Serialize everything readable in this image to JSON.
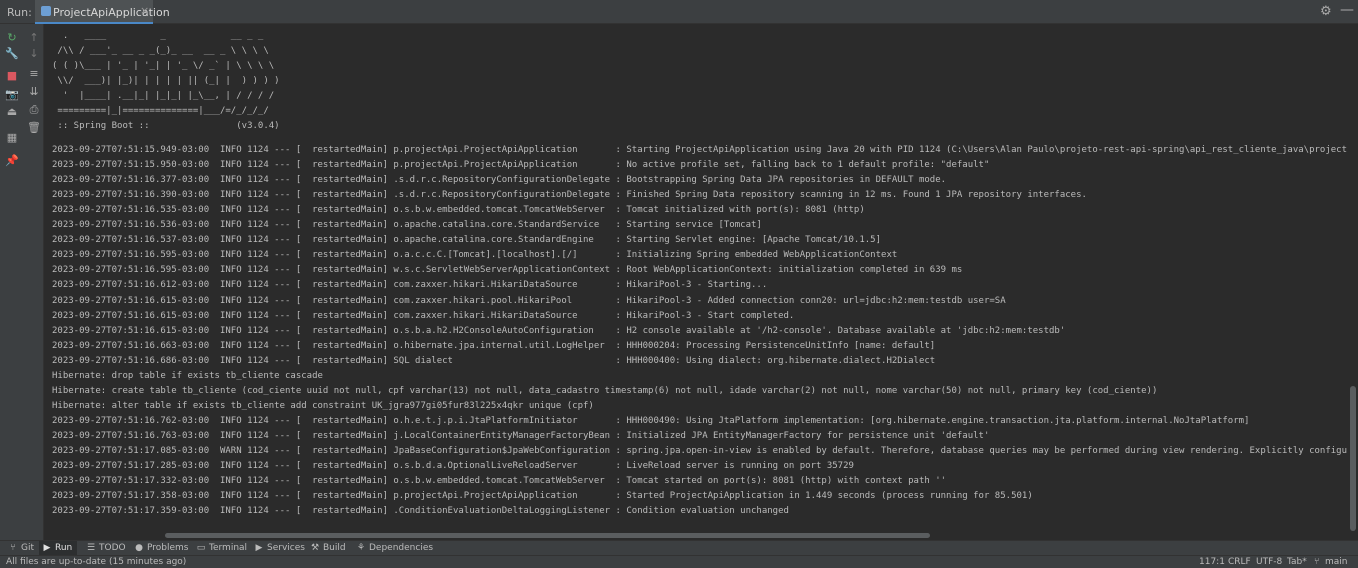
{
  "runbar": {
    "run_label": "Run:",
    "tab_title": "ProjectApiApplication",
    "tab_close": "×",
    "gear_icon": "⚙",
    "minimize_icon": "—"
  },
  "tools": {
    "left": [
      {
        "name": "rerun-icon",
        "glyph": "↻",
        "color": "#59a869"
      },
      {
        "name": "wrench-icon",
        "glyph": "🔧",
        "color": "#aaaaaa"
      },
      {
        "name": "stop-icon",
        "glyph": "■",
        "color": "#db5860"
      },
      {
        "name": "camera-icon",
        "glyph": "📷",
        "color": "#aaaaaa"
      },
      {
        "name": "exit-icon",
        "glyph": "⏏",
        "color": "#aaaaaa"
      },
      {
        "name": "layout-icon",
        "glyph": "▦",
        "color": "#aaaaaa"
      },
      {
        "name": "pin-icon",
        "glyph": "📌",
        "color": "#aaaaaa"
      }
    ],
    "second": [
      {
        "name": "up-arrow-icon",
        "glyph": "↑",
        "color": "#777777"
      },
      {
        "name": "down-arrow-icon",
        "glyph": "↓",
        "color": "#777777"
      },
      {
        "name": "soft-wrap-icon",
        "glyph": "≡",
        "color": "#aaaaaa"
      },
      {
        "name": "scroll-to-end-icon",
        "glyph": "⇊",
        "color": "#aaaaaa"
      },
      {
        "name": "print-icon",
        "glyph": "⎙",
        "color": "#aaaaaa"
      },
      {
        "name": "trash-icon",
        "glyph": "🗑",
        "color": "#aaaaaa"
      }
    ]
  },
  "banner": [
    "  .   ____          _            __ _ _",
    " /\\\\ / ___'_ __ _ _(_)_ __  __ _ \\ \\ \\ \\",
    "( ( )\\___ | '_ | '_| | '_ \\/ _` | \\ \\ \\ \\",
    " \\\\/  ___)| |_)| | | | | || (_| |  ) ) ) )",
    "  '  |____| .__|_| |_|_| |_\\__, | / / / /",
    " =========|_|==============|___/=/_/_/_/",
    " :: Spring Boot ::                (v3.0.4)"
  ],
  "logs": [
    "2023-09-27T07:51:15.949-03:00  INFO 1124 --- [  restartedMain] p.projectApi.ProjectApiApplication       : Starting ProjectApiApplication using Java 20 with PID 1124 (C:\\Users\\Alan Paulo\\projeto-rest-api-spring\\api_rest_cliente_java\\projectApi\\target\\classes",
    "2023-09-27T07:51:15.950-03:00  INFO 1124 --- [  restartedMain] p.projectApi.ProjectApiApplication       : No active profile set, falling back to 1 default profile: \"default\"",
    "2023-09-27T07:51:16.377-03:00  INFO 1124 --- [  restartedMain] .s.d.r.c.RepositoryConfigurationDelegate : Bootstrapping Spring Data JPA repositories in DEFAULT mode.",
    "2023-09-27T07:51:16.390-03:00  INFO 1124 --- [  restartedMain] .s.d.r.c.RepositoryConfigurationDelegate : Finished Spring Data repository scanning in 12 ms. Found 1 JPA repository interfaces.",
    "2023-09-27T07:51:16.535-03:00  INFO 1124 --- [  restartedMain] o.s.b.w.embedded.tomcat.TomcatWebServer  : Tomcat initialized with port(s): 8081 (http)",
    "2023-09-27T07:51:16.536-03:00  INFO 1124 --- [  restartedMain] o.apache.catalina.core.StandardService   : Starting service [Tomcat]",
    "2023-09-27T07:51:16.537-03:00  INFO 1124 --- [  restartedMain] o.apache.catalina.core.StandardEngine    : Starting Servlet engine: [Apache Tomcat/10.1.5]",
    "2023-09-27T07:51:16.595-03:00  INFO 1124 --- [  restartedMain] o.a.c.c.C.[Tomcat].[localhost].[/]       : Initializing Spring embedded WebApplicationContext",
    "2023-09-27T07:51:16.595-03:00  INFO 1124 --- [  restartedMain] w.s.c.ServletWebServerApplicationContext : Root WebApplicationContext: initialization completed in 639 ms",
    "2023-09-27T07:51:16.612-03:00  INFO 1124 --- [  restartedMain] com.zaxxer.hikari.HikariDataSource       : HikariPool-3 - Starting...",
    "2023-09-27T07:51:16.615-03:00  INFO 1124 --- [  restartedMain] com.zaxxer.hikari.pool.HikariPool        : HikariPool-3 - Added connection conn20: url=jdbc:h2:mem:testdb user=SA",
    "2023-09-27T07:51:16.615-03:00  INFO 1124 --- [  restartedMain] com.zaxxer.hikari.HikariDataSource       : HikariPool-3 - Start completed.",
    "2023-09-27T07:51:16.615-03:00  INFO 1124 --- [  restartedMain] o.s.b.a.h2.H2ConsoleAutoConfiguration    : H2 console available at '/h2-console'. Database available at 'jdbc:h2:mem:testdb'",
    "2023-09-27T07:51:16.663-03:00  INFO 1124 --- [  restartedMain] o.hibernate.jpa.internal.util.LogHelper  : HHH000204: Processing PersistenceUnitInfo [name: default]",
    "2023-09-27T07:51:16.686-03:00  INFO 1124 --- [  restartedMain] SQL dialect                              : HHH000400: Using dialect: org.hibernate.dialect.H2Dialect",
    "Hibernate: drop table if exists tb_cliente cascade",
    "Hibernate: create table tb_cliente (cod_ciente uuid not null, cpf varchar(13) not null, data_cadastro timestamp(6) not null, idade varchar(2) not null, nome varchar(50) not null, primary key (cod_ciente))",
    "Hibernate: alter table if exists tb_cliente add constraint UK_jgra977gi05fur83l225x4qkr unique (cpf)",
    "2023-09-27T07:51:16.762-03:00  INFO 1124 --- [  restartedMain] o.h.e.t.j.p.i.JtaPlatformInitiator       : HHH000490: Using JtaPlatform implementation: [org.hibernate.engine.transaction.jta.platform.internal.NoJtaPlatform]",
    "2023-09-27T07:51:16.763-03:00  INFO 1124 --- [  restartedMain] j.LocalContainerEntityManagerFactoryBean : Initialized JPA EntityManagerFactory for persistence unit 'default'",
    "2023-09-27T07:51:17.085-03:00  WARN 1124 --- [  restartedMain] JpaBaseConfiguration$JpaWebConfiguration : spring.jpa.open-in-view is enabled by default. Therefore, database queries may be performed during view rendering. Explicitly configure spring.jpa.open-",
    "2023-09-27T07:51:17.285-03:00  INFO 1124 --- [  restartedMain] o.s.b.d.a.OptionalLiveReloadServer       : LiveReload server is running on port 35729",
    "2023-09-27T07:51:17.332-03:00  INFO 1124 --- [  restartedMain] o.s.b.w.embedded.tomcat.TomcatWebServer  : Tomcat started on port(s): 8081 (http) with context path ''",
    "2023-09-27T07:51:17.358-03:00  INFO 1124 --- [  restartedMain] p.projectApi.ProjectApiApplication       : Started ProjectApiApplication in 1.449 seconds (process running for 85.501)",
    "2023-09-27T07:51:17.359-03:00  INFO 1124 --- [  restartedMain] .ConditionEvaluationDeltaLoggingListener : Condition evaluation unchanged"
  ],
  "toolwindows": [
    {
      "name": "tool-git",
      "icon": "⑂",
      "label": "Git",
      "active": false
    },
    {
      "name": "tool-run",
      "icon": "▶",
      "label": "Run",
      "active": true
    },
    {
      "name": "tool-todo",
      "icon": "☰",
      "label": "TODO",
      "active": false
    },
    {
      "name": "tool-problems",
      "icon": "●",
      "label": "Problems",
      "active": false
    },
    {
      "name": "tool-terminal",
      "icon": "▭",
      "label": "Terminal",
      "active": false
    },
    {
      "name": "tool-services",
      "icon": "▶",
      "label": "Services",
      "active": false
    },
    {
      "name": "tool-build",
      "icon": "⚒",
      "label": "Build",
      "active": false
    },
    {
      "name": "tool-dependencies",
      "icon": "⚘",
      "label": "Dependencies",
      "active": false
    }
  ],
  "status": {
    "message": "All files are up-to-date (15 minutes ago)",
    "position": "117:1",
    "line_sep": "CRLF",
    "encoding": "UTF-8",
    "indent": "Tab*",
    "branch_icon": "⑂",
    "branch": "main"
  }
}
